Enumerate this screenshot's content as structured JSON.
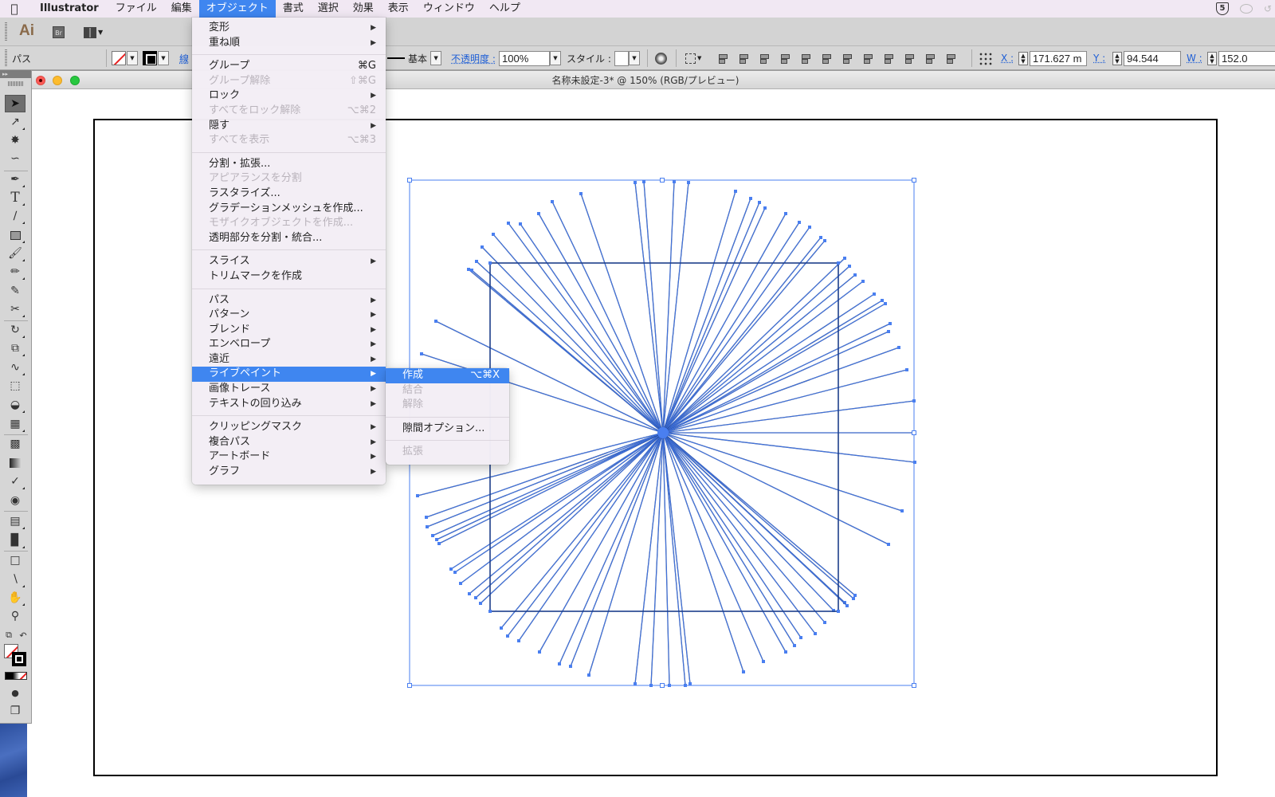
{
  "menubar": {
    "apple_icon": "apple-logo-icon",
    "items": [
      "Illustrator",
      "ファイル",
      "編集",
      "オブジェクト",
      "書式",
      "選択",
      "効果",
      "表示",
      "ウィンドウ",
      "ヘルプ"
    ],
    "active_index": 3,
    "status_icons": [
      "shield-s-icon",
      "chat-bubble-icon",
      "partial-icon"
    ],
    "shield_label": "5"
  },
  "appbar": {
    "logo": "Ai",
    "bridge_label": "Br",
    "arrange_icon": "arrange-documents-icon"
  },
  "controlbar": {
    "selection_type": "パス",
    "stroke_link": "線",
    "stroke_style": "基本",
    "opacity_label": "不透明度 :",
    "opacity_value": "100%",
    "style_label": "スタイル :",
    "x_label": "X :",
    "x_value": "171.627 m",
    "y_label": "Y :",
    "y_value": "94.544 mm",
    "w_label": "W :",
    "w_value": "152.0"
  },
  "document": {
    "title": "名称未設定-3* @ 150% (RGB/プレビュー)",
    "zoom": "150%",
    "color_mode": "RGB/プレビュー"
  },
  "tools": [
    "selection-tool",
    "direct-selection-tool",
    "magic-wand-tool",
    "lasso-tool",
    "pen-tool",
    "type-tool",
    "line-segment-tool",
    "rectangle-tool",
    "paintbrush-tool",
    "pencil-tool",
    "blob-brush-tool",
    "scissors-tool",
    "rotate-tool",
    "scale-tool",
    "puppet-warp-tool",
    "free-transform-tool",
    "shape-builder-tool",
    "perspective-grid-tool",
    "mesh-tool",
    "gradient-tool",
    "eyedropper-tool",
    "blend-tool",
    "symbol-sprayer-tool",
    "column-graph-tool",
    "artboard-tool",
    "slice-tool",
    "hand-tool",
    "zoom-tool"
  ],
  "object_menu": {
    "groups": [
      [
        {
          "label": "変形",
          "submenu": true
        },
        {
          "label": "重ね順",
          "submenu": true
        }
      ],
      [
        {
          "label": "グループ",
          "shortcut": "⌘G"
        },
        {
          "label": "グループ解除",
          "shortcut": "⇧⌘G",
          "disabled": true
        },
        {
          "label": "ロック",
          "submenu": true
        },
        {
          "label": "すべてをロック解除",
          "shortcut": "⌥⌘2",
          "disabled": true
        },
        {
          "label": "隠す",
          "submenu": true
        },
        {
          "label": "すべてを表示",
          "shortcut": "⌥⌘3",
          "disabled": true
        }
      ],
      [
        {
          "label": "分割・拡張..."
        },
        {
          "label": "アピアランスを分割",
          "disabled": true
        },
        {
          "label": "ラスタライズ..."
        },
        {
          "label": "グラデーションメッシュを作成..."
        },
        {
          "label": "モザイクオブジェクトを作成...",
          "disabled": true
        },
        {
          "label": "透明部分を分割・統合..."
        }
      ],
      [
        {
          "label": "スライス",
          "submenu": true
        },
        {
          "label": "トリムマークを作成"
        }
      ],
      [
        {
          "label": "パス",
          "submenu": true
        },
        {
          "label": "パターン",
          "submenu": true
        },
        {
          "label": "ブレンド",
          "submenu": true
        },
        {
          "label": "エンベロープ",
          "submenu": true
        },
        {
          "label": "遠近",
          "submenu": true
        },
        {
          "label": "ライブペイント",
          "submenu": true,
          "highlighted": true
        },
        {
          "label": "画像トレース",
          "submenu": true
        },
        {
          "label": "テキストの回り込み",
          "submenu": true
        }
      ],
      [
        {
          "label": "クリッピングマスク",
          "submenu": true
        },
        {
          "label": "複合パス",
          "submenu": true
        },
        {
          "label": "アートボード",
          "submenu": true
        },
        {
          "label": "グラフ",
          "submenu": true
        }
      ]
    ]
  },
  "livepaint_submenu": {
    "groups": [
      [
        {
          "label": "作成",
          "shortcut": "⌥⌘X",
          "highlighted": true
        },
        {
          "label": "結合",
          "disabled": true
        },
        {
          "label": "解除",
          "disabled": true
        }
      ],
      [
        {
          "label": "隙間オプション..."
        }
      ],
      [
        {
          "label": "拡張",
          "disabled": true
        }
      ]
    ]
  },
  "colors": {
    "menu_highlight": "#3f86f0",
    "selection_blue": "#4a7ff0",
    "path_stroke": "#1d3f8a",
    "menubar_bg": "#f1e8f3"
  }
}
